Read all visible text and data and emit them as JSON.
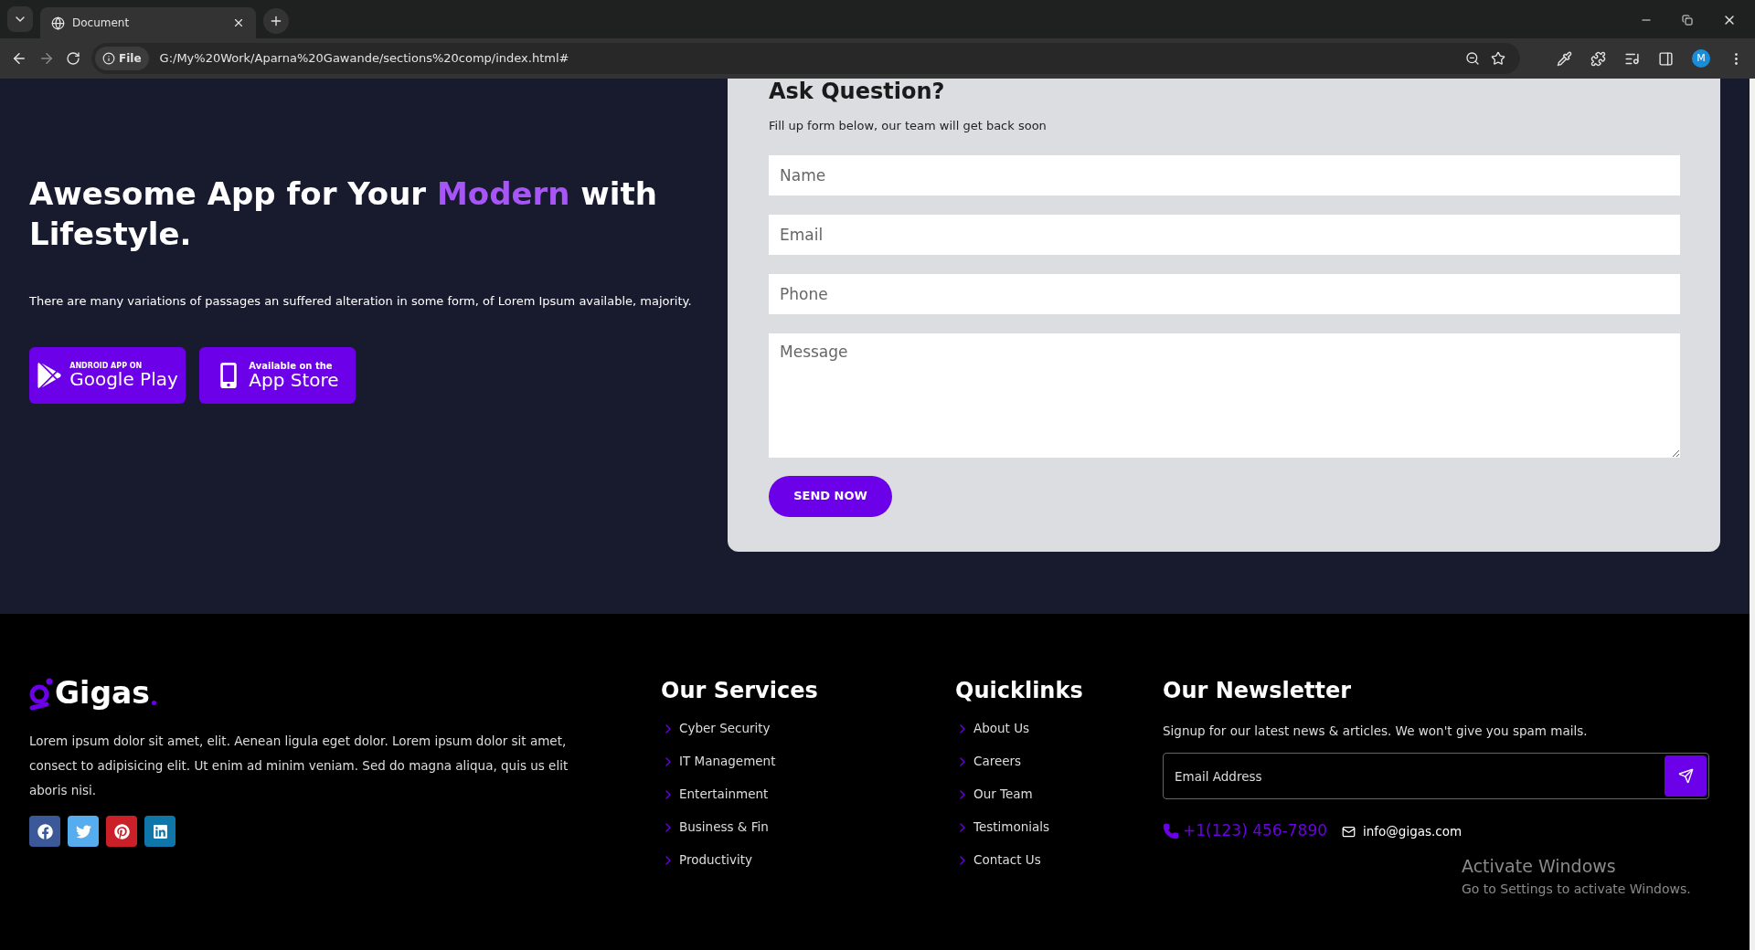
{
  "browser": {
    "tab_title": "Document",
    "url_badge": "File",
    "url": "G:/My%20Work/Aparna%20Gawande/sections%20comp/index.html#",
    "profile_initial": "M"
  },
  "hero": {
    "heading": "Awesome App for Your **Modern** with Lifestyle.",
    "description": "There are many variations of passages an suffered alteration in some form, of Lorem Ipsum available, majority.",
    "store_buttons": [
      {
        "kind": "google",
        "small": "ANDROID APP ON",
        "big": "Google Play"
      },
      {
        "kind": "apple",
        "small": "Available on the",
        "big": "App Store"
      }
    ]
  },
  "form": {
    "title": "Ask Question?",
    "subtitle": "Fill up form below, our team will get back soon",
    "fields": [
      {
        "kind": "input",
        "placeholder": "Name"
      },
      {
        "kind": "input",
        "placeholder": "Email"
      },
      {
        "kind": "input",
        "placeholder": "Phone"
      },
      {
        "kind": "textarea",
        "placeholder": "Message"
      }
    ],
    "submit": "SEND NOW"
  },
  "footer": {
    "logo": "Gigas",
    "about": "Lorem ipsum dolor sit amet, elit. Aenean ligula eget dolor. Lorem ipsum dolor sit amet, consect to adipisicing elit. Ut enim ad minim veniam. Sed do magna aliqua, quis us elit aboris nisi.",
    "socials": [
      {
        "kind": "facebook",
        "color": "#3b5998"
      },
      {
        "kind": "twitter",
        "color": "#55acee"
      },
      {
        "kind": "pinterest",
        "color": "#cb2027"
      },
      {
        "kind": "linkedin",
        "color": "#0e76a8"
      }
    ],
    "services": {
      "title": "Our Services",
      "items": [
        "Cyber Security",
        "IT Management",
        "Entertainment",
        "Business & Fin",
        "Productivity"
      ]
    },
    "quicklinks": {
      "title": "Quicklinks",
      "items": [
        "About Us",
        "Careers",
        "Our Team",
        "Testimonials",
        "Contact Us"
      ]
    },
    "newsletter": {
      "title": "Our Newsletter",
      "text": "Signup for our latest news & articles. We won't give you spam mails.",
      "placeholder": "Email Address",
      "phone": "+1(123) 456-7890",
      "email": "info@gigas.com"
    }
  },
  "os_overlay": {
    "title": "Activate Windows",
    "subtitle": "Go to Settings to activate Windows."
  }
}
